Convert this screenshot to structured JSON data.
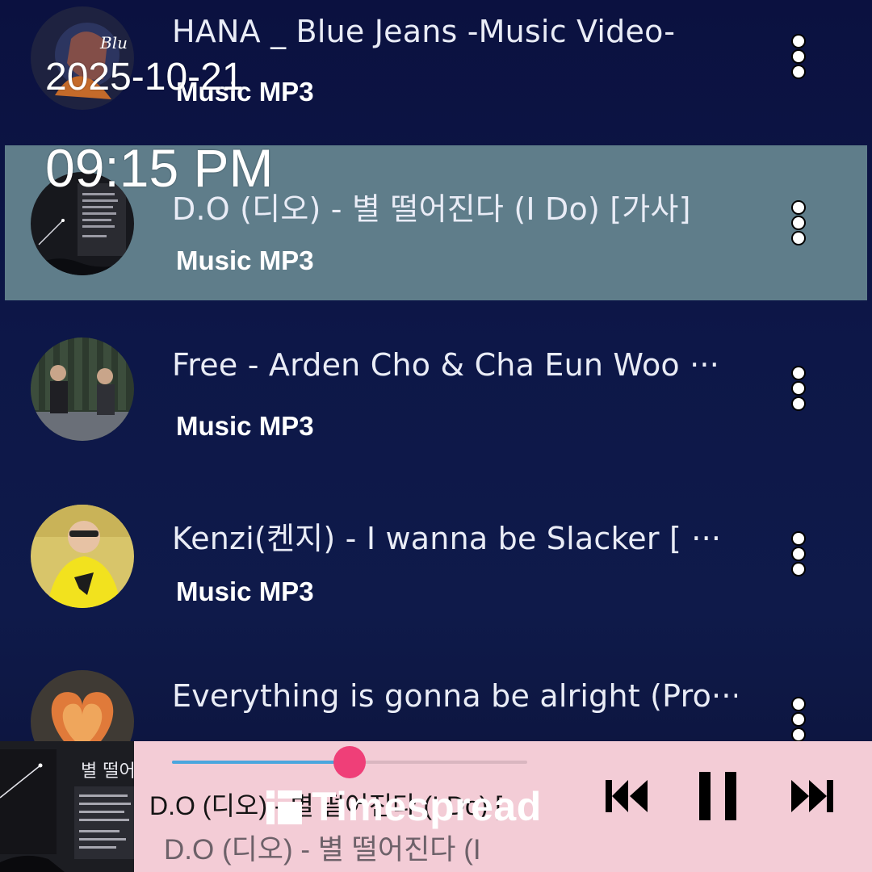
{
  "songs": [
    {
      "title": "HANA _ Blue Jeans -Music Video-",
      "subtitle": "Music MP3",
      "thumb": "hana-blue-jeans-cover"
    },
    {
      "title": "D.O (디오) - 별 떨어진다 (I Do) [가사]",
      "subtitle": "Music MP3",
      "thumb": "starry-night-lyrics-cover",
      "selected": true
    },
    {
      "title": "Free - Arden Cho & Cha Eun Woo ···",
      "subtitle": "Music MP3",
      "thumb": "two-singers-studio-photo"
    },
    {
      "title": "Kenzi(켄지) - I wanna be Slacker [ ···",
      "subtitle": "Music MP3",
      "thumb": "yellow-sweater-portrait"
    },
    {
      "title": "Everything is gonna be alright (Pro···",
      "subtitle": "",
      "thumb": "heart-cloud-cover"
    }
  ],
  "overlay": {
    "date": "2025-10-21",
    "time": "09:15 PM"
  },
  "player": {
    "title": "D.O (디오) - 별 떨어진다 (I Do) [",
    "subtitle": "D.O (디오) - 별 떨어진다 (I",
    "progress_fraction": 0.5,
    "controls": [
      "previous-icon",
      "pause-icon",
      "next-icon"
    ]
  },
  "watermark": {
    "text": "Timespread",
    "icon": "timespread-logo-icon"
  },
  "colors": {
    "background": "#0d1748",
    "selected_row": "#5f7d8a",
    "player_bg": "#f3ccd6",
    "seek_fill": "#4aa6de",
    "seek_thumb": "#ef3f78"
  }
}
